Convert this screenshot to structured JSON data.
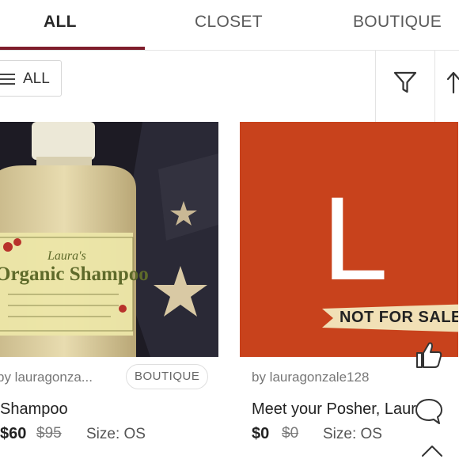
{
  "tabs": [
    {
      "label": "ALL"
    },
    {
      "label": "CLOSET"
    },
    {
      "label": "BOUTIQUE"
    }
  ],
  "toolbar": {
    "filter_label": "ALL",
    "filter_icon": "menu-icon",
    "funnel_icon": "filter-icon",
    "sort_icon": "sort-arrow-icon"
  },
  "listings": [
    {
      "seller": "by lauragonza...",
      "badge": "BOUTIQUE",
      "title": "Shampoo",
      "price": "$60",
      "original_price": "$95",
      "size": "Size: OS",
      "photo_label_brand": "Laura's",
      "photo_label_product": "Organic Shampoo"
    },
    {
      "seller": "by lauragonzale128",
      "title": "Meet your Posher, Laura",
      "price": "$0",
      "original_price": "$0",
      "size": "Size: OS",
      "image_letter": "L",
      "image_banner": "NOT FOR SALE"
    }
  ],
  "actions": {
    "like_icon": "thumbs-up-icon",
    "comment_icon": "comment-icon",
    "share_icon": "share-icon"
  },
  "colors": {
    "accent": "#7f1d2c",
    "card_red": "#c8421c"
  }
}
